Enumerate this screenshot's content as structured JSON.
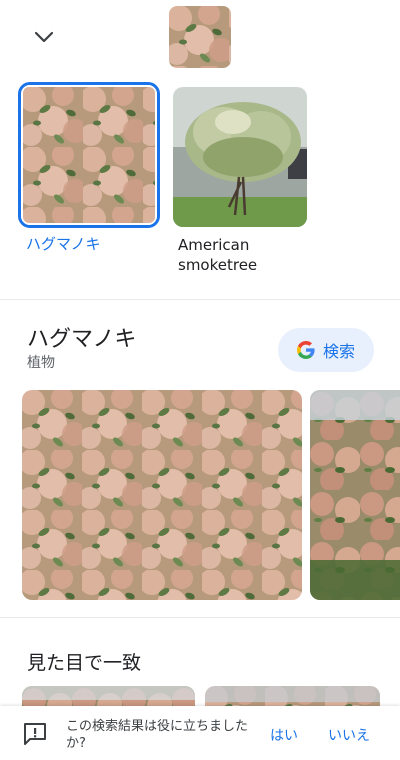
{
  "results": [
    {
      "label": "ハグマノキ",
      "selected": true
    },
    {
      "label": "American smoketree",
      "selected": false
    }
  ],
  "knowledge": {
    "title": "ハグマノキ",
    "subtitle": "植物",
    "search_label": "検索"
  },
  "visual_matches": {
    "title": "見た目で一致"
  },
  "feedback": {
    "question": "この検索結果は役に立ちましたか?",
    "yes": "はい",
    "no": "いいえ"
  },
  "colors": {
    "accent": "#1a73e8",
    "search_button_bg": "#e8f0fe",
    "smoke_pink": "#d9a58f",
    "foliage_green": "#5d7a45"
  },
  "icons": {
    "collapse": "chevron-down-icon",
    "google": "google-g-icon",
    "feedback": "feedback-icon"
  }
}
